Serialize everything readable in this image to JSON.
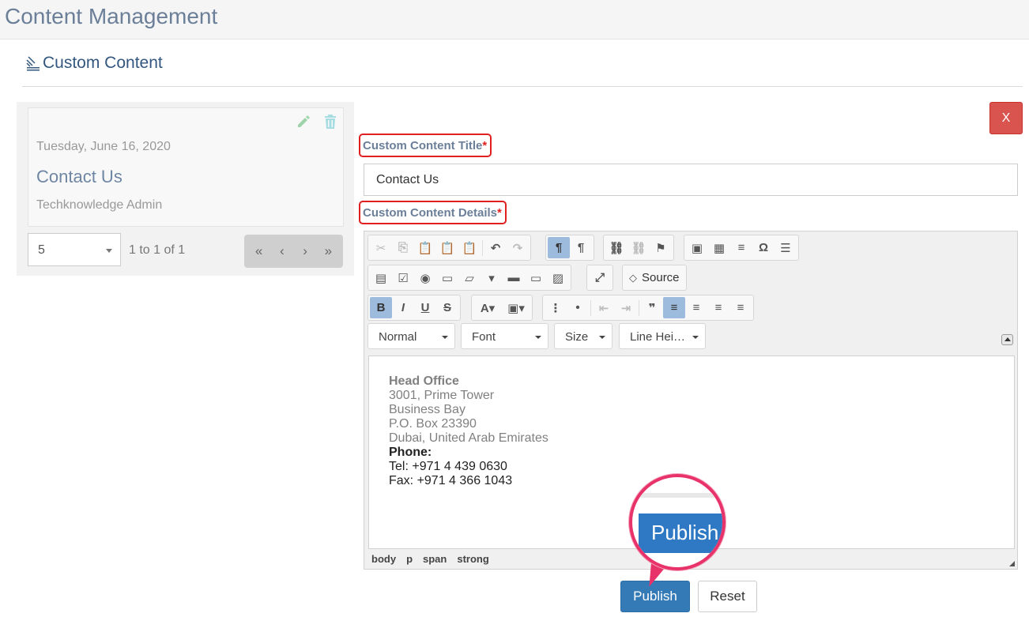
{
  "header": {
    "title": "Content Management"
  },
  "section": {
    "title": "Custom Content"
  },
  "list": {
    "items": [
      {
        "date": "Tuesday, June 16, 2020",
        "title": "Contact Us",
        "author": "Techknowledge Admin"
      }
    ],
    "pager": {
      "page_size": "5",
      "info": "1 to 1 of 1",
      "first": "«",
      "prev": "‹",
      "next": "›",
      "last": "»"
    }
  },
  "form": {
    "close_label": "X",
    "title_label": "Custom Content Title",
    "details_label": "Custom Content Details",
    "required_mark": "*",
    "title_value": "Contact Us",
    "toolbar": {
      "source_label": "Source",
      "format_combo": "Normal",
      "font_combo": "Font",
      "size_combo": "Size",
      "lineheight_combo": "Line Hei…"
    },
    "content": {
      "heading": "Head Office",
      "line1": "3001, Prime Tower",
      "line2": "Business Bay",
      "line3": "P.O. Box 23390",
      "line4": "Dubai, United Arab Emirates",
      "phone_label": "Phone:",
      "tel": "Tel: +971 4 439 0630",
      "fax": "Fax: +971 4 366 1043"
    },
    "path": [
      "body",
      "p",
      "span",
      "strong"
    ],
    "publish_label": "Publish",
    "reset_label": "Reset"
  },
  "callout": {
    "label": "Publish"
  },
  "colors": {
    "accent": "#337ab7",
    "danger": "#d9534f",
    "highlight": "#e8336a"
  }
}
